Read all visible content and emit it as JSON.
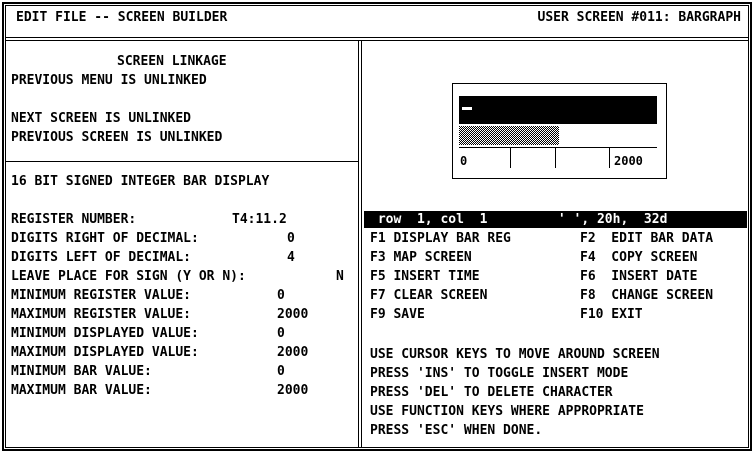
{
  "header": {
    "title": "EDIT FILE -- SCREEN BUILDER",
    "screen_label": "USER SCREEN #011: BARGRAPH"
  },
  "linkage": {
    "heading": "SCREEN LINKAGE",
    "previous_menu": "PREVIOUS MENU IS UNLINKED",
    "next_screen": "NEXT SCREEN IS UNLINKED",
    "previous_screen": "PREVIOUS SCREEN IS UNLINKED"
  },
  "bar_settings": {
    "heading": "16 BIT SIGNED INTEGER BAR DISPLAY",
    "fields": [
      {
        "label": "REGISTER NUMBER:",
        "value": "T4:11.2"
      },
      {
        "label": "DIGITS RIGHT OF DECIMAL:",
        "value": "0"
      },
      {
        "label": "DIGITS LEFT OF DECIMAL:",
        "value": "4"
      },
      {
        "label": "LEAVE PLACE FOR SIGN (Y OR N):",
        "value": "N"
      },
      {
        "label": "MINIMUM REGISTER VALUE:",
        "value": "0"
      },
      {
        "label": "MAXIMUM REGISTER VALUE:",
        "value": "2000"
      },
      {
        "label": "MINIMUM DISPLAYED VALUE:",
        "value": "0"
      },
      {
        "label": "MAXIMUM DISPLAYED VALUE:",
        "value": "2000"
      },
      {
        "label": "MINIMUM BAR VALUE:",
        "value": "0"
      },
      {
        "label": "MAXIMUM BAR VALUE:",
        "value": "2000"
      }
    ]
  },
  "preview": {
    "scale_min": "0",
    "scale_max": "2000"
  },
  "status": {
    "text": " row  1, col  1         ' ', 20h,  32d"
  },
  "function_keys": [
    {
      "left": "F1 DISPLAY BAR REG",
      "right": "F2  EDIT BAR DATA"
    },
    {
      "left": "F3 MAP SCREEN",
      "right": "F4  COPY SCREEN"
    },
    {
      "left": "F5 INSERT TIME",
      "right": "F6  INSERT DATE"
    },
    {
      "left": "F7 CLEAR SCREEN",
      "right": "F8  CHANGE SCREEN"
    },
    {
      "left": "F9 SAVE",
      "right": "F10 EXIT"
    }
  ],
  "help": [
    "USE CURSOR KEYS TO MOVE AROUND SCREEN",
    "PRESS 'INS' TO TOGGLE INSERT MODE",
    "PRESS 'DEL' TO DELETE CHARACTER",
    "USE FUNCTION KEYS WHERE APPROPRIATE",
    "PRESS 'ESC' WHEN DONE."
  ],
  "colors": {
    "background": "#ffffff",
    "foreground": "#000000"
  }
}
